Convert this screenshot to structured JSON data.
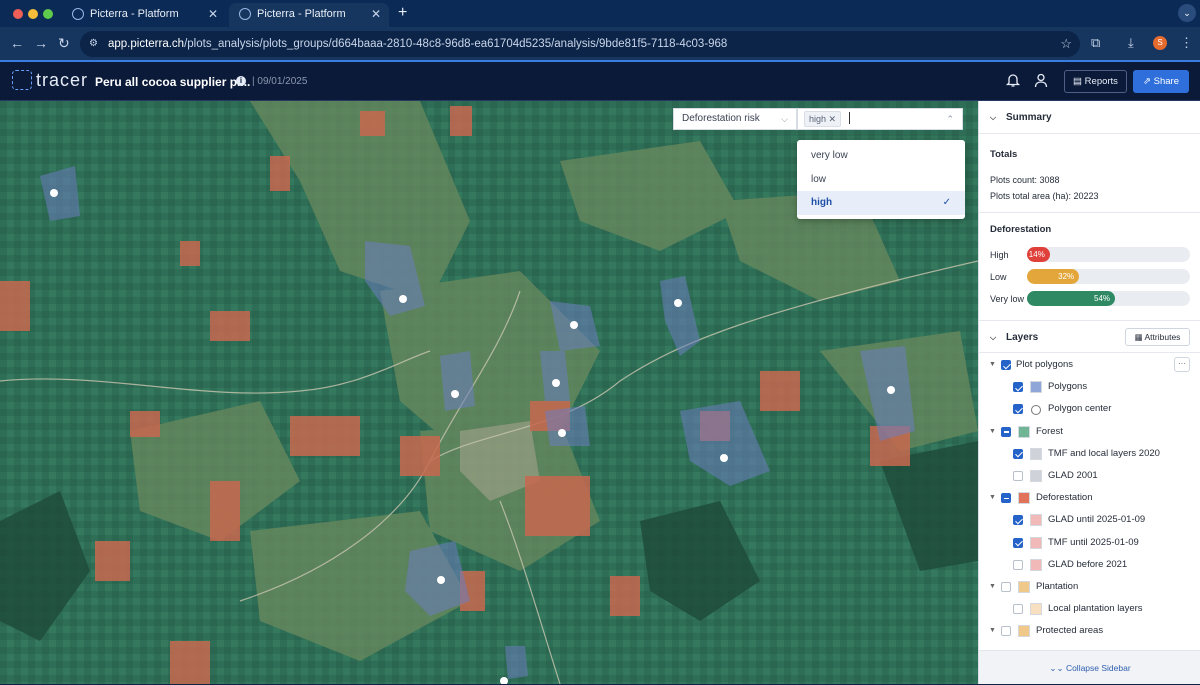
{
  "browser": {
    "tabs": [
      {
        "title": "Picterra - Platform",
        "active": false
      },
      {
        "title": "Picterra - Platform",
        "active": true
      }
    ],
    "new_tab": "+",
    "url_host": "app.picterra.ch",
    "url_path": "/plots_analysis/plots_groups/d664baaa-2810-48c8-96d8-ea61704d5235/analysis/9bde81f5-7118-4c03-968",
    "profile_initial": "S"
  },
  "app": {
    "logo_text": "tracer",
    "project_title": "Peru all cocoa supplier pl...",
    "project_date": "| 09/01/2025",
    "reports_label": "Reports",
    "share_label": "Share"
  },
  "filter": {
    "attribute": "Deforestation risk",
    "selected_tag": "high",
    "options": [
      {
        "label": "very low",
        "selected": false
      },
      {
        "label": "low",
        "selected": false
      },
      {
        "label": "high",
        "selected": true
      }
    ]
  },
  "summary": {
    "title": "Summary",
    "totals_title": "Totals",
    "plots_count": "Plots count: 3088",
    "plots_area": "Plots total area (ha): 20223",
    "deforestation_title": "Deforestation",
    "bars": [
      {
        "label": "High",
        "percent": 14,
        "text": "14%",
        "color": "#e0403a"
      },
      {
        "label": "Low",
        "percent": 32,
        "text": "32%",
        "color": "#e3a63b"
      },
      {
        "label": "Very low",
        "percent": 54,
        "text": "54%",
        "color": "#2f8a64"
      }
    ]
  },
  "layers": {
    "title": "Layers",
    "attributes_label": "Attributes",
    "items": [
      {
        "label": "Plot polygons",
        "level": 0,
        "state": "checked",
        "swatch": "none",
        "expanded": true
      },
      {
        "label": "Polygons",
        "level": 1,
        "state": "checked",
        "swatch": "#8fa6d8"
      },
      {
        "label": "Polygon center",
        "level": 1,
        "state": "checked",
        "swatch": "circle"
      },
      {
        "label": "Forest",
        "level": 0,
        "state": "partial",
        "swatch": "#6fb595",
        "expanded": true
      },
      {
        "label": "TMF and local layers 2020",
        "level": 1,
        "state": "checked",
        "swatch": "#cfd3d9"
      },
      {
        "label": "GLAD 2001",
        "level": 1,
        "state": "unchecked",
        "swatch": "#cfd3d9"
      },
      {
        "label": "Deforestation",
        "level": 0,
        "state": "partial",
        "swatch": "#e0735a",
        "expanded": true
      },
      {
        "label": "GLAD until 2025-01-09",
        "level": 1,
        "state": "checked",
        "swatch": "#f2b9b9"
      },
      {
        "label": "TMF until 2025-01-09",
        "level": 1,
        "state": "checked",
        "swatch": "#f2b9b9"
      },
      {
        "label": "GLAD before 2021",
        "level": 1,
        "state": "unchecked",
        "swatch": "#f2b9b9"
      },
      {
        "label": "Plantation",
        "level": 0,
        "state": "unchecked",
        "swatch": "#f0c98a",
        "expanded": true
      },
      {
        "label": "Local plantation layers",
        "level": 1,
        "state": "unchecked",
        "swatch": "#f7dfc0"
      },
      {
        "label": "Protected areas",
        "level": 0,
        "state": "unchecked",
        "swatch": "#f0c98a",
        "expanded": true
      }
    ],
    "collapse_label": "Collapse Sidebar"
  },
  "colors": {
    "forest": "#2f7a60",
    "deforestation": "#c8684f",
    "polygon": "#6b7ec0",
    "accent": "#2f6fdc"
  }
}
